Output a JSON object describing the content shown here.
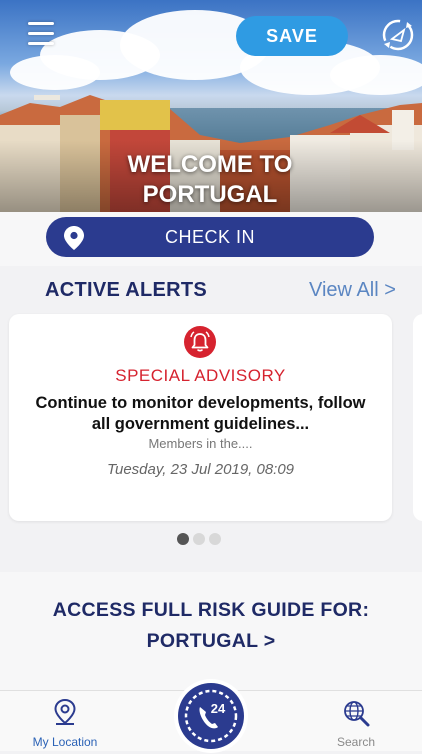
{
  "header": {
    "save_label": "SAVE",
    "title_line1": "WELCOME TO",
    "title_line2": "PORTUGAL"
  },
  "checkin": {
    "label": "CHECK IN"
  },
  "alerts": {
    "section_title": "ACTIVE ALERTS",
    "view_all_label": "View All >",
    "card": {
      "type": "SPECIAL ADVISORY",
      "body": "Continue to monitor developments, follow all government guidelines...",
      "members": "Members in the....",
      "date": "Tuesday, 23 Jul 2019, 08:09"
    },
    "pager": {
      "current": 1,
      "total": 3
    }
  },
  "risk_guide": {
    "line1": "ACCESS FULL RISK GUIDE FOR:",
    "line2": "PORTUGAL >"
  },
  "tabbar": {
    "my_location": "My Location",
    "search": "Search",
    "emergency_badge": "24"
  },
  "colors": {
    "brand_navy": "#2b3b8f",
    "save_blue": "#2f9be3",
    "alert_red": "#d6232f",
    "link_blue": "#5b86c2"
  }
}
